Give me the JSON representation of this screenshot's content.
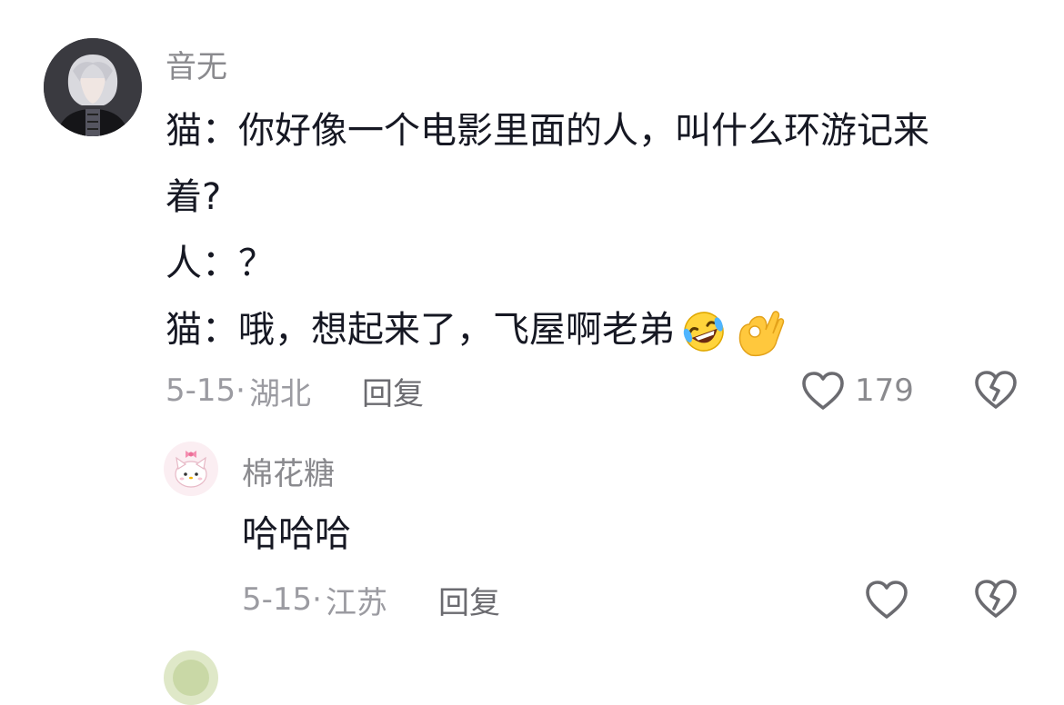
{
  "comments": [
    {
      "username": "音无",
      "lines": [
        "猫：你好像一个电影里面的人，叫什么环游记来",
        "着?",
        "人：？",
        "猫：哦，想起来了，飞屋啊老弟"
      ],
      "trailing_emojis": [
        "rolling-on-floor-laughing-emoji",
        "ok-hand-emoji"
      ],
      "date": "5-15",
      "separator": "·",
      "location": "湖北",
      "reply_label": "回复",
      "like_count": "179",
      "avatar_icon": "anime-boy-avatar"
    },
    {
      "username": "棉花糖",
      "lines": [
        "哈哈哈"
      ],
      "date": "5-15",
      "separator": "·",
      "location": "江苏",
      "reply_label": "回复",
      "like_count": "",
      "avatar_icon": "cartoon-cat-avatar"
    }
  ],
  "colors": {
    "username": "#8a8a8e",
    "body": "#161823",
    "meta": "#9b9ba1",
    "icon": "#6b6b70"
  }
}
